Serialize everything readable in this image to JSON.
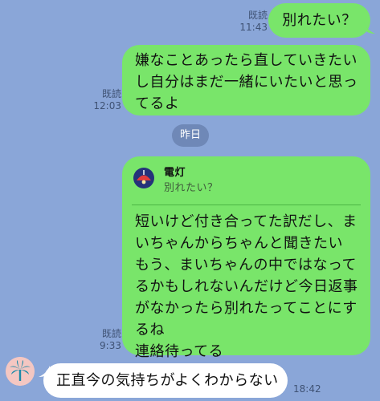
{
  "messages": [
    {
      "sender": "me",
      "text": "別れたい？",
      "read": "既読",
      "time": "11:43"
    },
    {
      "sender": "me",
      "lines": [
        "嫌なことあったら直していきたい",
        "し自分はまだ一緒にいたいと思っ",
        "てるよ"
      ],
      "read": "既読",
      "time": "12:03"
    },
    {
      "sender": "me",
      "quote": {
        "name": "電灯",
        "text": "別れたい？"
      },
      "lines": [
        "短いけど付き合ってた訳だし、ま",
        "いちゃんからちゃんと聞きたい",
        "もう、まいちゃんの中ではなって",
        "るかもしれないんだけど今日返事",
        "がなかったら別れたってことにす",
        "るね",
        "連絡待ってる"
      ],
      "read": "既読",
      "time": "9:33"
    },
    {
      "sender": "other",
      "text": "正直今の気持ちがよくわからない",
      "time": "18:42"
    }
  ],
  "date_separator": "昨日",
  "colors": {
    "background": "#8aa6d8",
    "my_bubble": "#79e56a",
    "their_bubble": "#ffffff"
  },
  "icons": {
    "quote_avatar": "lamp-avatar-icon",
    "other_avatar": "palm-tree-avatar-icon"
  }
}
